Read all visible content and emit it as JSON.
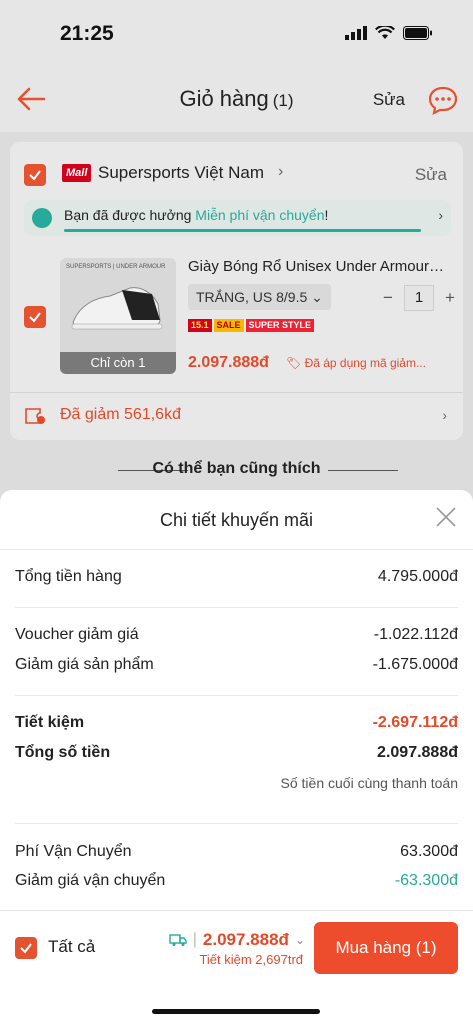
{
  "status_bar": {
    "time": "21:25"
  },
  "header": {
    "title": "Giỏ hàng",
    "count": "(1)",
    "edit_label": "Sửa"
  },
  "shop": {
    "mall_badge": "Mall",
    "name": "Supersports Việt Nam",
    "edit_label": "Sửa",
    "shipping_prefix": "Bạn đã được hưởng ",
    "shipping_highlight": "Miễn phí vận chuyển",
    "shipping_suffix": "!",
    "discount_text": "Đã giảm 561,6kđ"
  },
  "product": {
    "name": "Giày Bóng Rổ Unisex Under Armour Curry",
    "variant": "TRẮNG, US 8/9.5",
    "quantity": "1",
    "stock_label": "Chỉ còn 1",
    "price": "2.097.888đ",
    "voucher_note": "Đã áp dụng mã giảm...",
    "brand_text": "SUPERSPORTS | UNDER ARMOUR",
    "tags": [
      "15.1",
      "SALE",
      "SUPER STYLE"
    ]
  },
  "suggest_title": "Có thể bạn cũng thích",
  "sheet": {
    "title": "Chi tiết khuyến mãi",
    "rows": [
      {
        "label": "Tổng tiền hàng",
        "value": "4.795.000đ"
      },
      {
        "label": "Voucher giảm giá",
        "value": "-1.022.112đ"
      },
      {
        "label": "Giảm giá sản phẩm",
        "value": "-1.675.000đ"
      },
      {
        "label": "Tiết kiệm",
        "value": "-2.697.112đ"
      },
      {
        "label": "Tổng số tiền",
        "value": "2.097.888đ"
      },
      {
        "label": "Phí Vận Chuyển",
        "value": "63.300đ"
      },
      {
        "label": "Giảm giá vận chuyển",
        "value": "-63.300đ"
      }
    ],
    "final_note": "Số tiền cuối cùng thanh toán"
  },
  "footer": {
    "all_label": "Tất cả",
    "total": "2.097.888đ",
    "savings": "Tiết kiệm 2,697trđ",
    "buy_label": "Mua hàng (1)"
  },
  "colors": {
    "accent": "#ee4d2d",
    "price": "#e24a2a",
    "teal": "#26aa99"
  }
}
